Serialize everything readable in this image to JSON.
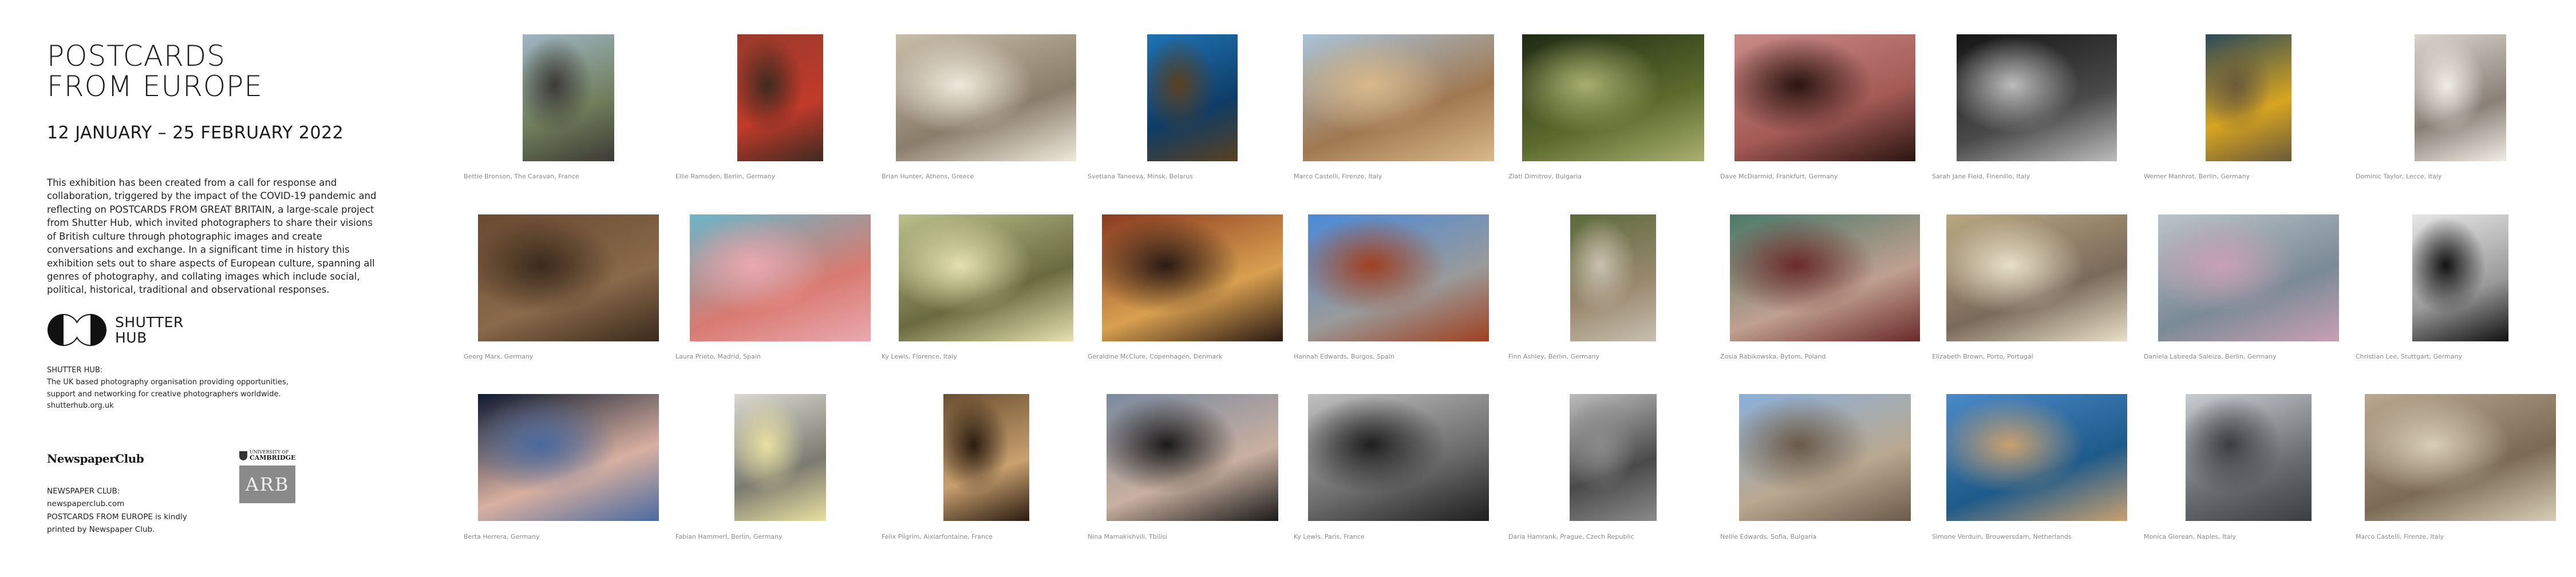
{
  "header": {
    "title_line1": "POSTCARDS",
    "title_line2": "FROM EUROPE",
    "dates": "12 JANUARY – 25 FEBRUARY 2022"
  },
  "intro": "This exhibition has been created from a call for response and collaboration, triggered by the impact of the COVID-19 pandemic and reflecting on POSTCARDS FROM GREAT BRITAIN, a large-scale project from Shutter Hub, which invited photographers to share their visions of British culture through photographic images and create conversations and exchange. In a significant time in history this exhibition sets out to share aspects of European culture, spanning all genres of photography, and collating images which include social, political, historical, traditional and observational responses.",
  "shutter_hub": {
    "logo_line1": "SHUTTER",
    "logo_line2": "HUB",
    "heading": "SHUTTER HUB:",
    "line1": "The UK based photography organisation providing opportunities,",
    "line2": "support and networking for creative photographers worldwide.",
    "url": "shutterhub.org.uk"
  },
  "newspaper_club": {
    "logo": "NewspaperClub",
    "heading": "NEWSPAPER CLUB:",
    "url": "newspaperclub.com",
    "line1": "POSTCARDS FROM EUROPE is kindly",
    "line2": "printed by Newspaper Club."
  },
  "cambridge": {
    "line1": "UNIVERSITY OF",
    "line2": "CAMBRIDGE",
    "arb": "ARB"
  },
  "rows": [
    [
      {
        "caption": "Bettie Bronson, The Caravan, France",
        "colors": [
          "#9fb6c4",
          "#6f7d5a",
          "#3d3a36"
        ]
      },
      {
        "caption": "Ellie Ramsden, Berlin, Germany",
        "colors": [
          "#9a3a2c",
          "#c23a2a",
          "#3e2a20"
        ]
      },
      {
        "caption": "Brian Hunter, Athens, Greece",
        "colors": [
          "#c9bfa8",
          "#8a7d6a",
          "#efe9dc"
        ]
      },
      {
        "caption": "Svetlana Taneeva, Minsk, Belarus",
        "colors": [
          "#1e73b4",
          "#0e3c66",
          "#5a4020"
        ]
      },
      {
        "caption": "Marco Castelli, Firenze, Italy",
        "colors": [
          "#a9c3d9",
          "#a07850",
          "#d9b98a"
        ]
      },
      {
        "caption": "Zlati Dimitrov, Bulgaria",
        "colors": [
          "#1f2a14",
          "#5c6b2c",
          "#a8b070"
        ]
      },
      {
        "caption": "Dave McDiarmid, Frankfurt, Germany",
        "colors": [
          "#c98a86",
          "#a35a55",
          "#2a1410"
        ]
      },
      {
        "caption": "Sarah Jane Field, Finenillo, Italy",
        "colors": [
          "#151515",
          "#4a4a4a",
          "#bcbcbc"
        ]
      },
      {
        "caption": "Werner Manhrot, Berlin, Germany",
        "colors": [
          "#2a4a5a",
          "#d9a520",
          "#6a5a3a"
        ]
      },
      {
        "caption": "Dominic Taylor, Lecce, Italy",
        "colors": [
          "#d9d4cc",
          "#8a8078",
          "#f0ece4"
        ]
      }
    ],
    [
      {
        "caption": "Georg Marx, Germany",
        "colors": [
          "#6a4a30",
          "#8a6a4a",
          "#3a2a1c"
        ]
      },
      {
        "caption": "Laura Prieto, Madrid, Spain",
        "colors": [
          "#6ab6c9",
          "#d97a70",
          "#e9a9b0"
        ]
      },
      {
        "caption": "Ky Lewis, Florence, Italy",
        "colors": [
          "#b9c08a",
          "#6a6a40",
          "#e6e0b0"
        ]
      },
      {
        "caption": "Geraldine McClure, Copenhagen, Denmark",
        "colors": [
          "#8a3a20",
          "#d9a050",
          "#2a1a14"
        ]
      },
      {
        "caption": "Hannah Edwards, Burgos, Spain",
        "colors": [
          "#4a8ad9",
          "#9a9a9a",
          "#a04020"
        ]
      },
      {
        "caption": "Finn Ashley, Berlin, Germany",
        "colors": [
          "#5a6a3a",
          "#9a8a70",
          "#c9c0b0"
        ]
      },
      {
        "caption": "Zosia Rabikowska, Bytom, Poland",
        "colors": [
          "#4a7a6a",
          "#c0a090",
          "#6a2a2a"
        ]
      },
      {
        "caption": "Elizabeth Brown, Porto, Portugal",
        "colors": [
          "#b9a880",
          "#7a6a5a",
          "#e9e0c8"
        ]
      },
      {
        "caption": "Daniela Labeeda Saleiza, Berlin, Germany",
        "colors": [
          "#bcc4c9",
          "#7a8a96",
          "#c9a0b4"
        ]
      },
      {
        "caption": "Christian Lee, Stuttgart, Germany",
        "colors": [
          "#e6e6e6",
          "#9a9a9a",
          "#111111"
        ]
      }
    ],
    [
      {
        "caption": "Berta Herrera, Germany",
        "colors": [
          "#0e1a30",
          "#d9b0a0",
          "#4a6aa0"
        ]
      },
      {
        "caption": "Fabian Hammerl, Berlin, Germany",
        "colors": [
          "#d9d9d0",
          "#7a7a70",
          "#e9e0a0"
        ]
      },
      {
        "caption": "Felix Pilgrim, Aixlarfontaine, France",
        "colors": [
          "#6a5030",
          "#c9a070",
          "#2a1c10"
        ]
      },
      {
        "caption": "Nina Mamakishvili, Tbilisi",
        "colors": [
          "#7a8aa0",
          "#c9b0a0",
          "#1a1a1a"
        ]
      },
      {
        "caption": "Ky Lewis, Paris, France",
        "colors": [
          "#c0c0c0",
          "#6a6a6a",
          "#1e1e1e"
        ]
      },
      {
        "caption": "Daria Hamrank, Prague, Czech Republic",
        "colors": [
          "#bcbcbc",
          "#4a4a4a",
          "#8a8a8a"
        ]
      },
      {
        "caption": "Nellie Edwards, Sofia, Bulgaria",
        "colors": [
          "#8ab0d9",
          "#b9a890",
          "#6a5a4a"
        ]
      },
      {
        "caption": "Simone Verduin, Brouwersdam, Netherlands",
        "colors": [
          "#4a8ac9",
          "#1e5a8a",
          "#c9a070"
        ]
      },
      {
        "caption": "Monica Glerean, Naples, Italy",
        "colors": [
          "#c9ccd0",
          "#6a6e72",
          "#3a3e42"
        ]
      },
      {
        "caption": "Marco Castelli, Firenze, Italy",
        "colors": [
          "#b9a990",
          "#7a6a55",
          "#d9cdb8"
        ]
      }
    ]
  ]
}
